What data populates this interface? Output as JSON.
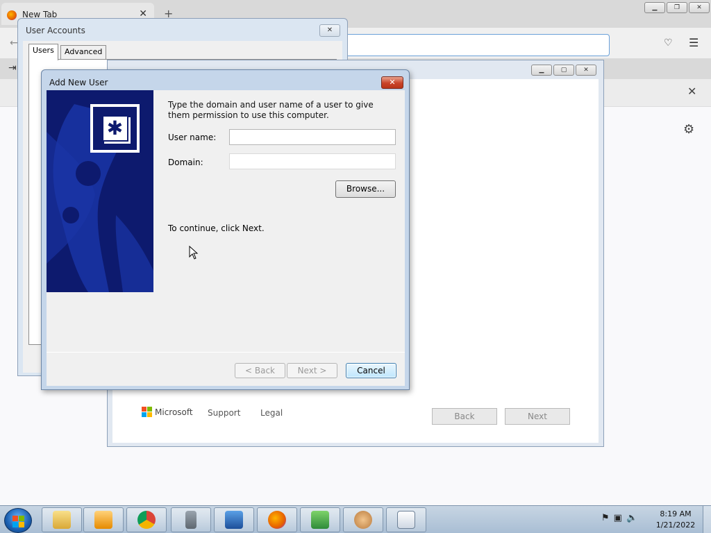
{
  "browser": {
    "tab_title": "New Tab",
    "tab_close": "✕",
    "new_tab": "+"
  },
  "user_accounts": {
    "title": "User Accounts",
    "close": "✕",
    "tabs": [
      "Users",
      "Advanced"
    ]
  },
  "setup_window": {
    "microsoft": "Microsoft",
    "support": "Support",
    "legal": "Legal",
    "back": "Back",
    "next": "Next"
  },
  "dialog": {
    "title": "Add New User",
    "close": "✕",
    "instruction": "Type the domain and user name of a user to give them permission to use this computer.",
    "user_name_label": "User name:",
    "user_name_value": "",
    "domain_label": "Domain:",
    "domain_value": "",
    "browse": "Browse...",
    "continue_text": "To continue, click Next.",
    "back": "< Back",
    "next": "Next >",
    "cancel": "Cancel"
  },
  "taskbar": {
    "time": "8:19 AM",
    "date": "1/21/2022",
    "items": [
      "explorer-icon",
      "media-player-icon",
      "chrome-icon",
      "server-lock-icon",
      "network-computer-icon",
      "firefox-icon",
      "download-icon",
      "users-icon",
      "document-icon"
    ]
  },
  "colors": {
    "dialog_art_bg": "#0d1a6e",
    "cancel_accent": "#3c7fb1"
  }
}
